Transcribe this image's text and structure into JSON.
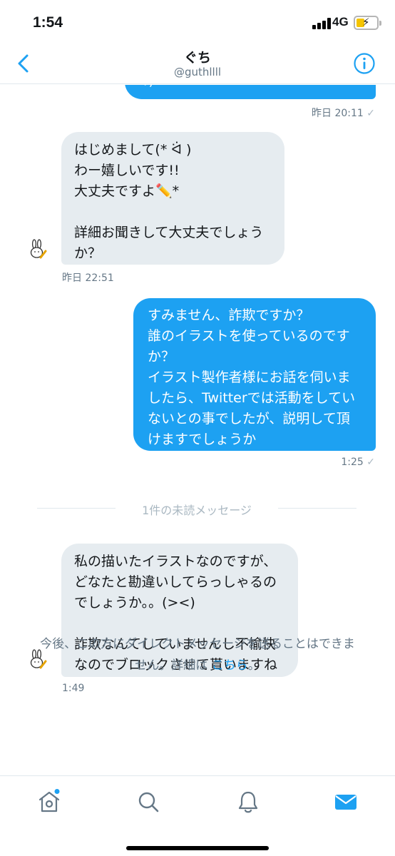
{
  "status_bar": {
    "time": "1:54",
    "network": "4G"
  },
  "header": {
    "title": "ぐち",
    "handle": "@guthllll"
  },
  "messages": [
    {
      "lines": [
        "：)"
      ],
      "time": "昨日 20:11",
      "check": "✓"
    },
    {
      "lines": [
        "はじめまして(* ᐛ )",
        "わー嬉しいです!!",
        "大丈夫ですよ✏️*",
        "",
        "詳細お聞きして大丈夫でしょう",
        "か？"
      ],
      "time": "昨日 22:51"
    },
    {
      "lines": [
        "すみません、詐欺ですか？",
        "誰のイラストを使っているのです",
        "か？",
        "イラスト製作者様にお話を伺いま",
        "したら、Twitterでは活動をしてい",
        "ないとの事でしたが、説明して頂",
        "けますでしょうか"
      ],
      "time": "1:25",
      "check": "✓"
    },
    {
      "lines": [
        "私の描いたイラストなのですが、",
        "どなたと勘違いしてらっしゃるの",
        "でしょうか。。(><)",
        "",
        "詐欺なんてしていませんし不愉快",
        "なのでブロックさせて貰いますね"
      ],
      "time": "1:49"
    }
  ],
  "unread_divider": "1件の未読メッセージ",
  "notice": {
    "line1": "今後、この方にダイレクトメッセージを送ることはできま",
    "line2_prefix": "せん。詳細は ",
    "link": "こちら",
    "line2_suffix": "。"
  },
  "tabs": [
    "home-icon",
    "search-icon",
    "notifications-icon",
    "messages-icon"
  ],
  "colors": {
    "accent": "#1da1f2",
    "incoming_bubble": "#e6ecf0",
    "muted": "#657786"
  }
}
